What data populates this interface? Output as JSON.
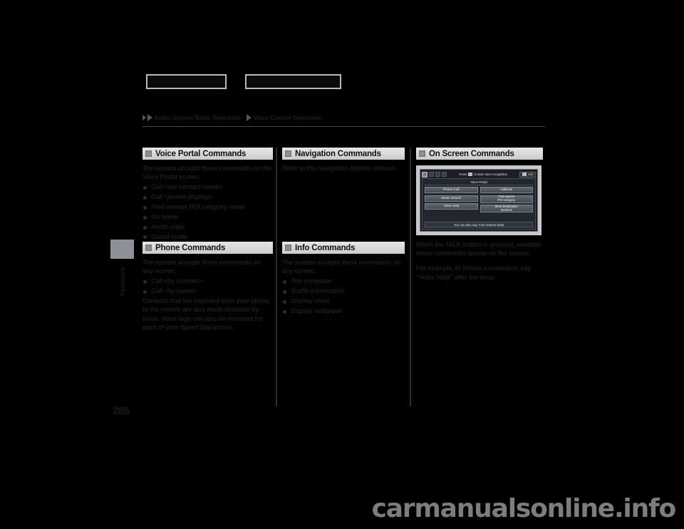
{
  "document": {
    "breadcrumb": [
      "Audio System Basic Operation",
      "Voice Control Operation"
    ],
    "page_number": "285",
    "margin_tab_label": "Features",
    "watermark": "carmanualsonline.info"
  },
  "top_boxes": [
    {
      "label": ""
    },
    {
      "label": ""
    }
  ],
  "sections": {
    "voice_portal": {
      "title": "Voice Portal Commands",
      "intro": "The system accepts these commands on the Voice Portal screen.",
      "commands": [
        "Call <our contact name>",
        "Call <phone display>",
        "Find nearest POI category name",
        "Go home",
        "Audio page",
        "Guard mode"
      ]
    },
    "phone": {
      "title": "Phone Commands",
      "intro": "The system accepts these commands on any screen.",
      "commands": [
        "Call <by number>",
        "Call <by name>"
      ],
      "note": "Contacts that are imported from your phone to the vehicle are also made available by voice. Voice tags can also be recorded for each of your Speed Dial entries."
    },
    "navigation": {
      "title": "Navigation Commands",
      "intro": "Refer to the Navigation System Manual."
    },
    "info": {
      "title": "Info Commands",
      "intro": "The system accepts these commands on any screen.",
      "commands": [
        "Trip computer",
        "Traffic information",
        "Display clock",
        "Display wallpaper"
      ]
    },
    "on_screen": {
      "title": "On Screen Commands",
      "note_1": "When the  TALK  button is pressed, available voice commands appear on the screen.",
      "note_2": "For example, to initiate a command, say “Voice Help” after the beep.",
      "inline_icon_name": "talk-button-icon"
    }
  },
  "device_screen": {
    "topbar": {
      "press_text_before": "Press",
      "press_text_after": "to start voice recognition",
      "exit_label": "exit",
      "key_icon_name": "talk-key-icon"
    },
    "portal_title": "Voice Portal",
    "buttons_left": [
      "Phone Call",
      "Music Search",
      "Voice Help"
    ],
    "buttons_right": [
      "Address",
      "Find nearest\nPOI category",
      "More Destination\nMethods"
    ],
    "hint": "You can also say: Find nearest bank"
  },
  "colors": {
    "page_background": "#000000",
    "header_bar": "#dcdcdc",
    "margin_tab": "#8d9096",
    "device_frame": "#c9c9c9",
    "watermark": "#7d7d7d"
  }
}
